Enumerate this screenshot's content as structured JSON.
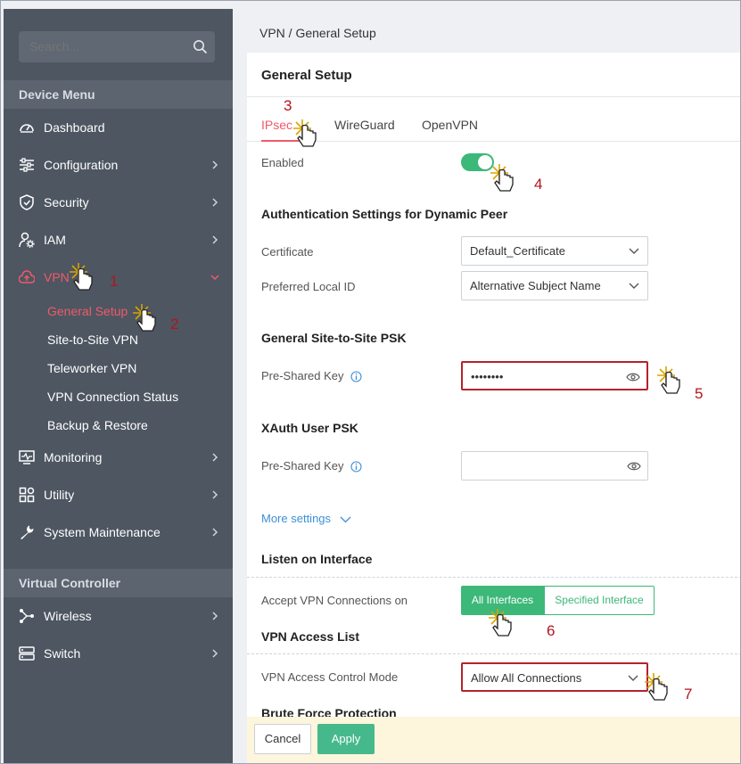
{
  "sidebar": {
    "search": {
      "placeholder": "Search..."
    },
    "device_menu_title": "Device Menu",
    "items": [
      {
        "label": "Dashboard",
        "icon": "dashboard-icon"
      },
      {
        "label": "Configuration",
        "icon": "sliders-icon"
      },
      {
        "label": "Security",
        "icon": "shield-icon"
      },
      {
        "label": "IAM",
        "icon": "user-gear-icon"
      },
      {
        "label": "VPN",
        "icon": "cloud-upload-icon"
      },
      {
        "label": "Monitoring",
        "icon": "monitor-icon"
      },
      {
        "label": "Utility",
        "icon": "utility-icon"
      },
      {
        "label": "System Maintenance",
        "icon": "wrench-icon"
      }
    ],
    "vpn_submenu": [
      "General Setup",
      "Site-to-Site VPN",
      "Teleworker VPN",
      "VPN Connection Status",
      "Backup & Restore"
    ],
    "virtual_controller_title": "Virtual Controller",
    "vc_items": [
      {
        "label": "Wireless",
        "icon": "wireless-icon"
      },
      {
        "label": "Switch",
        "icon": "switch-icon"
      }
    ]
  },
  "breadcrumb": "VPN / General Setup",
  "card": {
    "title": "General Setup",
    "tabs": [
      "IPsec",
      "WireGuard",
      "OpenVPN"
    ],
    "enabled_label": "Enabled",
    "enabled": true,
    "auth_heading": "Authentication Settings for Dynamic Peer",
    "certificate_label": "Certificate",
    "certificate_value": "Default_Certificate",
    "preferred_local_id_label": "Preferred Local ID",
    "preferred_local_id_value": "Alternative Subject Name",
    "s2s_psk_heading": "General Site-to-Site PSK",
    "psk_label": "Pre-Shared Key",
    "psk_value": "••••••••",
    "xauth_heading": "XAuth User PSK",
    "xauth_psk_label": "Pre-Shared Key",
    "xauth_psk_value": "",
    "more_settings": "More settings",
    "listen_heading": "Listen on Interface",
    "accept_label": "Accept VPN Connections on",
    "interface_options": [
      "All Interfaces",
      "Specified Interface"
    ],
    "access_heading": "VPN Access List",
    "access_mode_label": "VPN Access Control Mode",
    "access_mode_value": "Allow All Connections",
    "brute_force_heading": "Brute Force Protection"
  },
  "footer": {
    "cancel": "Cancel",
    "apply": "Apply"
  },
  "annotations": [
    "1",
    "2",
    "3",
    "4",
    "5",
    "6",
    "7"
  ],
  "colors": {
    "accent_red": "#f05a6a",
    "green": "#3cb878",
    "sidebar": "#4d5661",
    "callout": "#b4141d"
  }
}
